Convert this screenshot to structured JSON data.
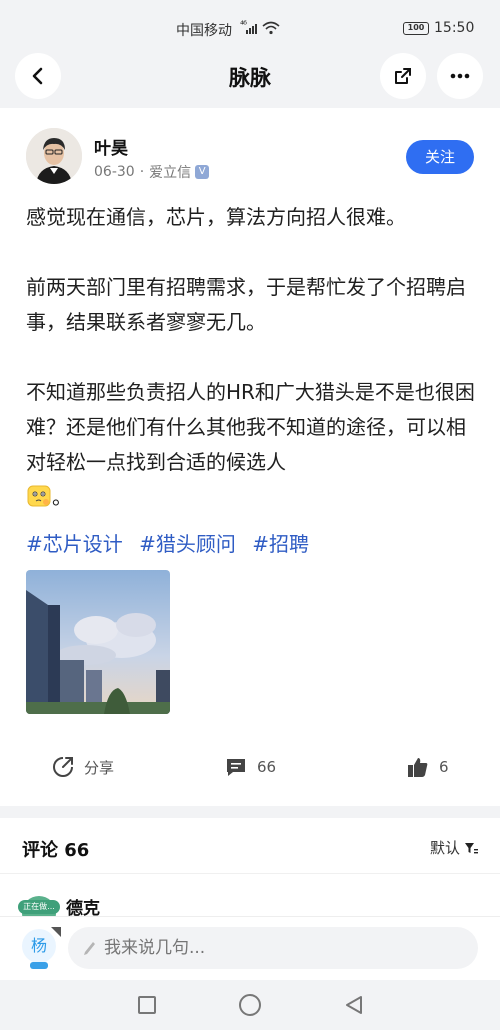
{
  "status_bar": {
    "carrier": "中国移动",
    "network": "⁴⁶",
    "battery": "100",
    "time": "15:50"
  },
  "header": {
    "title": "脉脉",
    "back_icon": "chevron-left-icon",
    "share_icon": "external-share-icon",
    "more_icon": "more-dots-icon"
  },
  "post": {
    "author": "叶昊",
    "date": "06-30",
    "meta_separator": "·",
    "company": "爱立信",
    "verified_badge": "V",
    "follow_label": "关注",
    "paragraphs": [
      "感觉现在通信，芯片，算法方向招人很难。",
      "前两天部门里有招聘需求，于是帮忙发了个招聘启事，结果联系者寥寥无几。",
      "不知道那些负责招人的HR和广大猎头是不是也很困难？还是他们有什么其他我不知道的途径，可以相对轻松一点找到合适的候选人"
    ],
    "emoji_icon": "thinking-face-emoji",
    "final_punct": "。",
    "tags": [
      "#芯片设计",
      "#猎头顾问",
      "#招聘"
    ],
    "image_icon": "city-sky-photo"
  },
  "actions": {
    "share_label": "分享",
    "comment_count": "66",
    "like_count": "6"
  },
  "comments": {
    "title": "评论 66",
    "sort_label": "默认",
    "first": {
      "name": "德克",
      "status_badge": "正在做..."
    }
  },
  "input": {
    "avatar_char": "杨",
    "placeholder": "我来说几句..."
  },
  "colors": {
    "accent": "#2f6ef2",
    "tag": "#2f5cc4",
    "background_gray": "#f2f3f5"
  }
}
